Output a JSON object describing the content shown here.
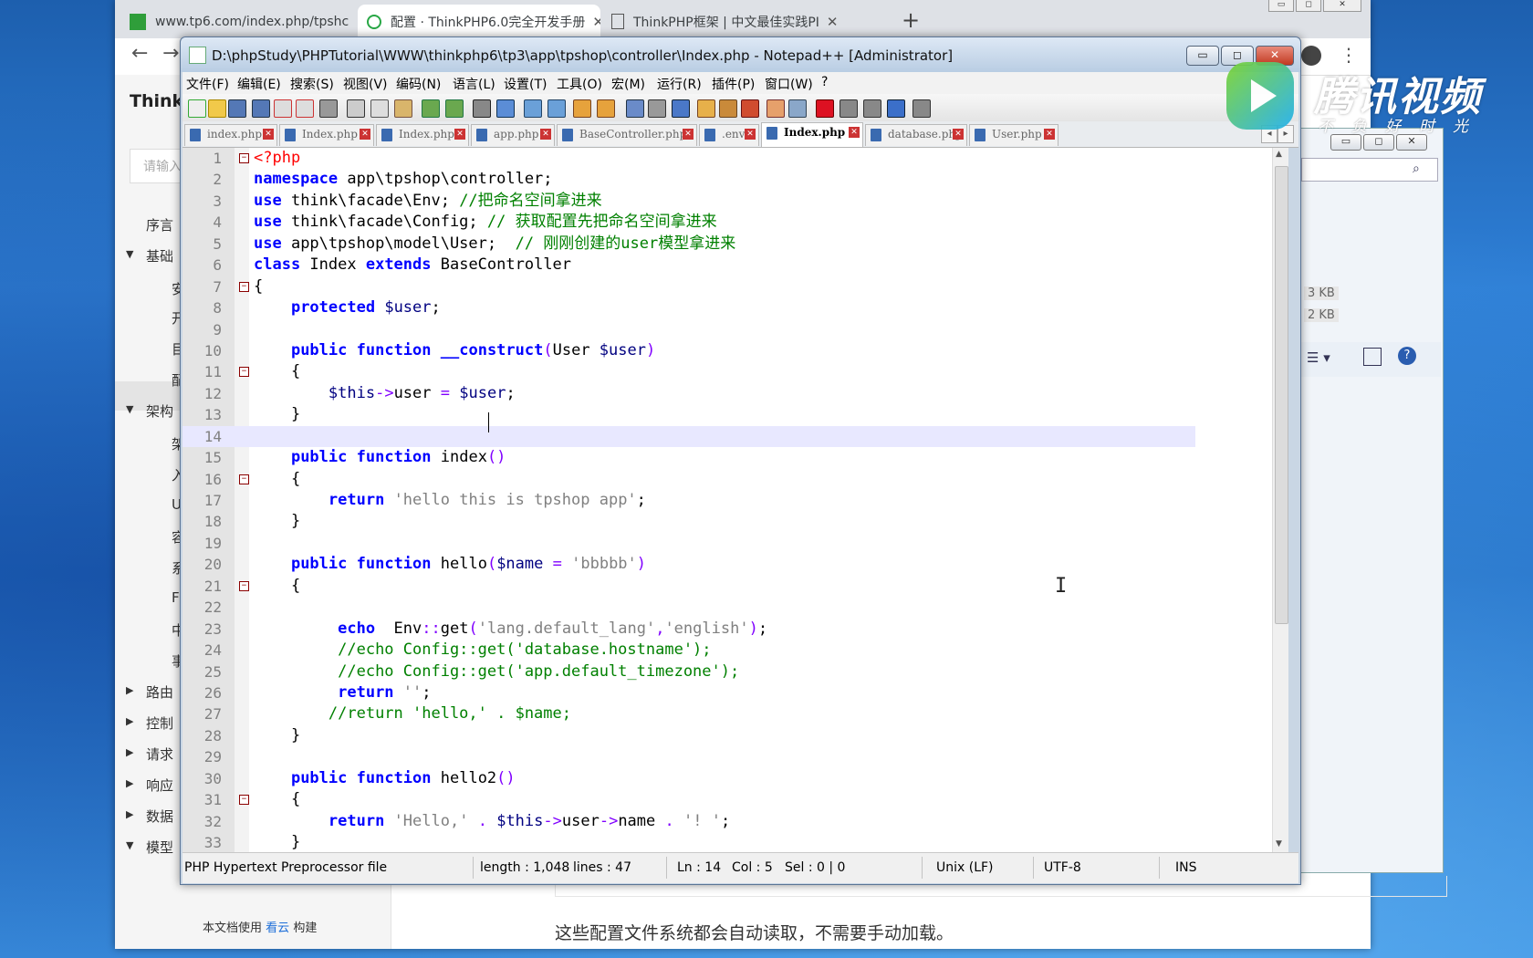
{
  "browser": {
    "tabs": [
      {
        "title": "www.tp6.com/index.php/tpshc",
        "active": false
      },
      {
        "title": "配置 · ThinkPHP6.0完全开发手册",
        "active": true
      },
      {
        "title": "ThinkPHP框架 | 中文最佳实践PI",
        "active": false
      }
    ],
    "new_tab": "+"
  },
  "doc": {
    "brand": "ThinkF",
    "search_placeholder": "请输入",
    "nav": [
      {
        "label": "序言",
        "type": "item"
      },
      {
        "label": "基础",
        "type": "group-open"
      },
      {
        "label": "安",
        "type": "sub"
      },
      {
        "label": "开",
        "type": "sub"
      },
      {
        "label": "目",
        "type": "sub"
      },
      {
        "label": "配",
        "type": "sub"
      },
      {
        "label": "架构",
        "type": "group-open"
      },
      {
        "label": "架",
        "type": "sub"
      },
      {
        "label": "入",
        "type": "sub"
      },
      {
        "label": "U",
        "type": "sub"
      },
      {
        "label": "容",
        "type": "sub"
      },
      {
        "label": "系",
        "type": "sub"
      },
      {
        "label": "F",
        "type": "sub"
      },
      {
        "label": "中",
        "type": "sub"
      },
      {
        "label": "事",
        "type": "sub"
      },
      {
        "label": "路由",
        "type": "group-closed"
      },
      {
        "label": "控制",
        "type": "group-closed"
      },
      {
        "label": "请求",
        "type": "group-closed"
      },
      {
        "label": "响应",
        "type": "group-closed"
      },
      {
        "label": "数据",
        "type": "group-closed"
      },
      {
        "label": "模型",
        "type": "group-open"
      }
    ],
    "footer_prefix": "本文档使用",
    "footer_link": "看云",
    "footer_suffix": "构建",
    "main_line": "这些配置文件系统都会自动读取，不需要手动加载。"
  },
  "explorer": {
    "sizes": [
      "3 KB",
      "2 KB"
    ]
  },
  "watermark": {
    "name": "腾讯视频",
    "slogan": "不负好时光"
  },
  "npp": {
    "title": "D:\\phpStudy\\PHPTutorial\\WWW\\thinkphp6\\tp3\\app\\tpshop\\controller\\Index.php - Notepad++ [Administrator]",
    "menu": [
      "文件(F)",
      "编辑(E)",
      "搜索(S)",
      "视图(V)",
      "编码(N)",
      "语言(L)",
      "设置(T)",
      "工具(O)",
      "宏(M)",
      "运行(R)",
      "插件(P)",
      "窗口(W)",
      "?"
    ],
    "tabs": [
      {
        "label": "index.php",
        "active": false
      },
      {
        "label": "Index.php",
        "active": false
      },
      {
        "label": "Index.php",
        "active": false
      },
      {
        "label": "app.php",
        "active": false
      },
      {
        "label": "BaseController.php",
        "active": false
      },
      {
        "label": ".env",
        "active": false
      },
      {
        "label": "Index.php",
        "active": true
      },
      {
        "label": "database.php",
        "active": false
      },
      {
        "label": "User.php",
        "active": false
      }
    ],
    "code": [
      [
        [
          "tag",
          "<?php"
        ]
      ],
      [
        [
          "kw",
          "namespace"
        ],
        [
          "fn",
          " app\\tpshop\\controller;"
        ]
      ],
      [
        [
          "kw",
          "use"
        ],
        [
          "fn",
          " think\\facade\\Env; "
        ],
        [
          "cm",
          "//把命名空间拿进来"
        ]
      ],
      [
        [
          "kw",
          "use"
        ],
        [
          "fn",
          " think\\facade\\Config; "
        ],
        [
          "cm",
          "// 获取配置先把命名空间拿进来"
        ]
      ],
      [
        [
          "kw",
          "use"
        ],
        [
          "fn",
          " app\\tpshop\\model\\User;  "
        ],
        [
          "cm",
          "// 刚刚创建的user模型拿进来"
        ]
      ],
      [
        [
          "kw",
          "class"
        ],
        [
          "fn",
          " Index "
        ],
        [
          "kw",
          "extends"
        ],
        [
          "fn",
          " BaseController"
        ]
      ],
      [
        [
          "fn",
          "{"
        ]
      ],
      [
        [
          "fn",
          "    "
        ],
        [
          "kw",
          "protected"
        ],
        [
          "fn",
          " "
        ],
        [
          "var",
          "$user"
        ],
        [
          "fn",
          ";"
        ]
      ],
      [
        [
          "fn",
          ""
        ]
      ],
      [
        [
          "fn",
          "    "
        ],
        [
          "kw",
          "public"
        ],
        [
          "fn",
          " "
        ],
        [
          "kw",
          "function"
        ],
        [
          "fn",
          " "
        ],
        [
          "kw",
          "__construct"
        ],
        [
          "op",
          "("
        ],
        [
          "fn",
          "User "
        ],
        [
          "var",
          "$user"
        ],
        [
          "op",
          ")"
        ]
      ],
      [
        [
          "fn",
          "    {"
        ]
      ],
      [
        [
          "fn",
          "        "
        ],
        [
          "var",
          "$this"
        ],
        [
          "op",
          "->"
        ],
        [
          "fn",
          "user "
        ],
        [
          "op",
          "="
        ],
        [
          "fn",
          " "
        ],
        [
          "var",
          "$user"
        ],
        [
          "fn",
          ";"
        ]
      ],
      [
        [
          "fn",
          "    }"
        ]
      ],
      [
        [
          "fn",
          ""
        ]
      ],
      [
        [
          "fn",
          "    "
        ],
        [
          "kw",
          "public"
        ],
        [
          "fn",
          " "
        ],
        [
          "kw",
          "function"
        ],
        [
          "fn",
          " index"
        ],
        [
          "op",
          "()"
        ]
      ],
      [
        [
          "fn",
          "    {"
        ]
      ],
      [
        [
          "fn",
          "        "
        ],
        [
          "kw",
          "return"
        ],
        [
          "fn",
          " "
        ],
        [
          "str",
          "'hello this is tpshop app'"
        ],
        [
          "fn",
          ";"
        ]
      ],
      [
        [
          "fn",
          "    }"
        ]
      ],
      [
        [
          "fn",
          ""
        ]
      ],
      [
        [
          "fn",
          "    "
        ],
        [
          "kw",
          "public"
        ],
        [
          "fn",
          " "
        ],
        [
          "kw",
          "function"
        ],
        [
          "fn",
          " hello"
        ],
        [
          "op",
          "("
        ],
        [
          "var",
          "$name"
        ],
        [
          "fn",
          " "
        ],
        [
          "op",
          "="
        ],
        [
          "fn",
          " "
        ],
        [
          "str",
          "'bbbbb'"
        ],
        [
          "op",
          ")"
        ]
      ],
      [
        [
          "fn",
          "    {"
        ]
      ],
      [
        [
          "fn",
          ""
        ]
      ],
      [
        [
          "fn",
          "         "
        ],
        [
          "kw",
          "echo"
        ],
        [
          "fn",
          "  Env"
        ],
        [
          "op",
          "::"
        ],
        [
          "fn",
          "get"
        ],
        [
          "op",
          "("
        ],
        [
          "str",
          "'lang.default_lang'"
        ],
        [
          "op",
          ","
        ],
        [
          "str",
          "'english'"
        ],
        [
          "op",
          ")"
        ],
        [
          "fn",
          ";"
        ]
      ],
      [
        [
          "fn",
          "         "
        ],
        [
          "cm",
          "//echo Config::get('database.hostname');"
        ]
      ],
      [
        [
          "fn",
          "         "
        ],
        [
          "cm",
          "//echo Config::get('app.default_timezone');"
        ]
      ],
      [
        [
          "fn",
          "         "
        ],
        [
          "kw",
          "return"
        ],
        [
          "fn",
          " "
        ],
        [
          "str",
          "''"
        ],
        [
          "fn",
          ";"
        ]
      ],
      [
        [
          "fn",
          "        "
        ],
        [
          "cm",
          "//return 'hello,' . $name;"
        ]
      ],
      [
        [
          "fn",
          "    }"
        ]
      ],
      [
        [
          "fn",
          ""
        ]
      ],
      [
        [
          "fn",
          "    "
        ],
        [
          "kw",
          "public"
        ],
        [
          "fn",
          " "
        ],
        [
          "kw",
          "function"
        ],
        [
          "fn",
          " hello2"
        ],
        [
          "op",
          "()"
        ]
      ],
      [
        [
          "fn",
          "    {"
        ]
      ],
      [
        [
          "fn",
          "        "
        ],
        [
          "kw",
          "return"
        ],
        [
          "fn",
          " "
        ],
        [
          "str",
          "'Hello,'"
        ],
        [
          "fn",
          " "
        ],
        [
          "op",
          "."
        ],
        [
          "fn",
          " "
        ],
        [
          "var",
          "$this"
        ],
        [
          "op",
          "->"
        ],
        [
          "fn",
          "user"
        ],
        [
          "op",
          "->"
        ],
        [
          "fn",
          "name "
        ],
        [
          "op",
          "."
        ],
        [
          "fn",
          " "
        ],
        [
          "str",
          "'! '"
        ],
        [
          "fn",
          ";"
        ]
      ],
      [
        [
          "fn",
          "    }"
        ]
      ]
    ],
    "current_line": 14,
    "status": {
      "file_type": "PHP Hypertext Preprocessor file",
      "length": "length : 1,048",
      "lines": "lines : 47",
      "ln": "Ln : 14",
      "col": "Col : 5",
      "sel": "Sel : 0 | 0",
      "eol": "Unix (LF)",
      "encoding": "UTF-8",
      "mode": "INS"
    }
  }
}
